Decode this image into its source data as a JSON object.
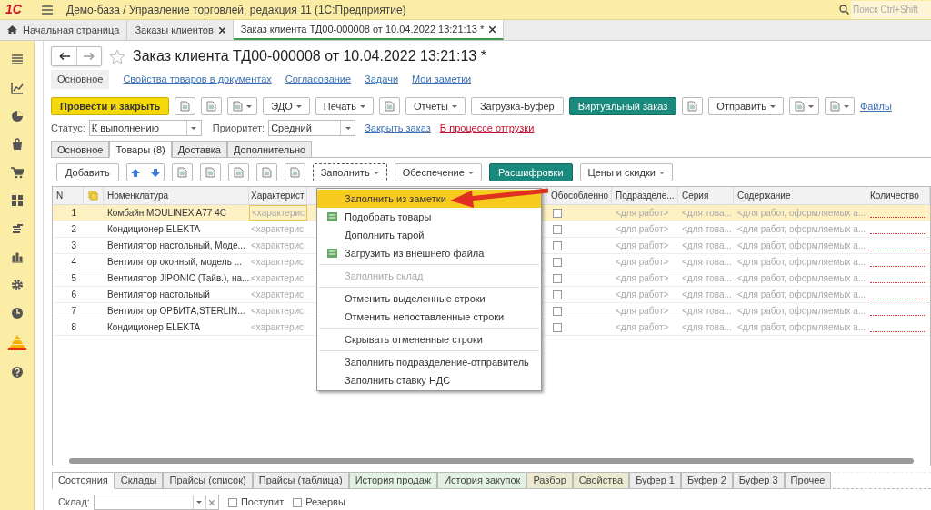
{
  "window": {
    "logo": "1С",
    "title": "Демо-база / Управление торговлей, редакция 11  (1С:Предприятие)",
    "search_placeholder": "Поиск Ctrl+Shift"
  },
  "tabs": [
    {
      "label": "Начальная страница",
      "selected": false,
      "closable": false
    },
    {
      "label": "Заказы клиентов",
      "selected": false,
      "closable": true
    },
    {
      "label": "Заказ клиента ТД00-000008 от 10.04.2022 13:21:13 *",
      "selected": true,
      "closable": true
    }
  ],
  "document": {
    "title": "Заказ клиента ТД00-000008 от 10.04.2022 13:21:13 *",
    "nav_links": [
      {
        "label": "Основное",
        "selected": true
      },
      {
        "label": "Свойства товаров в документах",
        "selected": false
      },
      {
        "label": "Согласование",
        "selected": false
      },
      {
        "label": "Задачи",
        "selected": false
      },
      {
        "label": "Мои заметки",
        "selected": false
      }
    ],
    "toolbar": [
      {
        "kind": "primary",
        "label": "Провести и закрыть"
      },
      {
        "kind": "icon"
      },
      {
        "kind": "icon"
      },
      {
        "kind": "icon_menu"
      },
      {
        "kind": "menu",
        "label": "ЭДО"
      },
      {
        "kind": "menu",
        "label": "Печать"
      },
      {
        "kind": "icon"
      },
      {
        "kind": "menu",
        "label": "Отчеты"
      },
      {
        "kind": "button",
        "label": "Загрузка-Буфер"
      },
      {
        "kind": "teal",
        "label": "Виртуальный заказ"
      },
      {
        "kind": "icon"
      },
      {
        "kind": "menu",
        "label": "Отправить"
      },
      {
        "kind": "icon_menu"
      },
      {
        "kind": "icon_menu"
      },
      {
        "kind": "link",
        "label": "Файлы"
      }
    ],
    "status": {
      "label": "Статус:",
      "value": "К выполнению"
    },
    "priority": {
      "label": "Приоритет:",
      "value": "Средний"
    },
    "close_link": "Закрыть заказ",
    "state_link": "В процессе отгрузки",
    "form_tabs": [
      {
        "label": "Основное",
        "selected": false
      },
      {
        "label": "Товары (8)",
        "selected": true
      },
      {
        "label": "Доставка",
        "selected": false
      },
      {
        "label": "Дополнительно",
        "selected": false
      }
    ]
  },
  "table_toolbar": [
    {
      "kind": "button",
      "label": "Добавить"
    },
    {
      "kind": "arrows"
    },
    {
      "kind": "icon"
    },
    {
      "kind": "icon"
    },
    {
      "kind": "icon"
    },
    {
      "kind": "icon"
    },
    {
      "kind": "icon"
    },
    {
      "kind": "menu",
      "label": "Заполнить",
      "selected": true
    },
    {
      "kind": "menu",
      "label": "Обеспечение",
      "selected": false
    },
    {
      "kind": "teal",
      "label": "Расшифровки"
    },
    {
      "kind": "menu",
      "label": "Цены и скидки",
      "selected": false
    }
  ],
  "table": {
    "columns": [
      "N",
      "Номенклатура",
      "Характерист",
      "Обособленно",
      "Подразделе...",
      "Серия",
      "Содержание",
      "Количество"
    ],
    "rows": [
      {
        "n": "1",
        "name": "Комбайн MOULINEX  A77 4C",
        "characteristic": "<характерис",
        "separate": false,
        "department": "<для работ>",
        "series": "<для това...",
        "content": "<для работ, оформляемых а...",
        "selected": true
      },
      {
        "n": "2",
        "name": "Кондиционер ELEKTA",
        "characteristic": "<характерис",
        "separate": false,
        "department": "<для работ>",
        "series": "<для това...",
        "content": "<для работ, оформляемых а...",
        "selected": false
      },
      {
        "n": "3",
        "name": "Вентилятор настольный, Моде...",
        "characteristic": "<характерис",
        "separate": false,
        "department": "<для работ>",
        "series": "<для това...",
        "content": "<для работ, оформляемых а...",
        "selected": false
      },
      {
        "n": "4",
        "name": "Вентилятор оконный, модель ...",
        "characteristic": "<характерис",
        "separate": false,
        "department": "<для работ>",
        "series": "<для това...",
        "content": "<для работ, оформляемых а...",
        "selected": false
      },
      {
        "n": "5",
        "name": "Вентилятор JIPONIC (Тайв.), на...",
        "characteristic": "<характерис",
        "separate": false,
        "department": "<для работ>",
        "series": "<для това...",
        "content": "<для работ, оформляемых а...",
        "selected": false
      },
      {
        "n": "6",
        "name": "Вентилятор настольный",
        "characteristic": "<характерис",
        "separate": false,
        "department": "<для работ>",
        "series": "<для това...",
        "content": "<для работ, оформляемых а...",
        "selected": false
      },
      {
        "n": "7",
        "name": "Вентилятор ОРБИТА,STERLIN...",
        "characteristic": "<характерис",
        "separate": false,
        "department": "<для работ>",
        "series": "<для това...",
        "content": "<для работ, оформляемых а...",
        "selected": false
      },
      {
        "n": "8",
        "name": "Кондиционер ELEKTA",
        "characteristic": "<характерис",
        "separate": false,
        "department": "<для работ>",
        "series": "<для това...",
        "content": "<для работ, оформляемых а...",
        "selected": false
      }
    ]
  },
  "fill_menu": [
    {
      "kind": "item",
      "label": "Заполнить из заметки",
      "selected": true,
      "disabled": false,
      "icon": false
    },
    {
      "kind": "item",
      "label": "Подобрать товары",
      "selected": false,
      "disabled": false,
      "icon": true
    },
    {
      "kind": "item",
      "label": "Дополнить тарой",
      "selected": false,
      "disabled": false,
      "icon": false
    },
    {
      "kind": "item",
      "label": "Загрузить из внешнего файла",
      "selected": false,
      "disabled": false,
      "icon": true
    },
    {
      "kind": "separator"
    },
    {
      "kind": "item",
      "label": "Заполнить склад",
      "selected": false,
      "disabled": true,
      "icon": false
    },
    {
      "kind": "separator"
    },
    {
      "kind": "item",
      "label": "Отменить выделенные строки",
      "selected": false,
      "disabled": false,
      "icon": false
    },
    {
      "kind": "item",
      "label": "Отменить непоставленные строки",
      "selected": false,
      "disabled": false,
      "icon": false
    },
    {
      "kind": "separator"
    },
    {
      "kind": "item",
      "label": "Скрывать отмененные строки",
      "selected": false,
      "disabled": false,
      "icon": false
    },
    {
      "kind": "separator"
    },
    {
      "kind": "item",
      "label": "Заполнить подразделение-отправитель",
      "selected": false,
      "disabled": false,
      "icon": false
    },
    {
      "kind": "item",
      "label": "Заполнить ставку НДС",
      "selected": false,
      "disabled": false,
      "icon": false
    }
  ],
  "bottom_tabs": [
    {
      "label": "Состояния",
      "selected": true,
      "color": "#ffffff"
    },
    {
      "label": "Склады",
      "selected": false,
      "color": "#ececec"
    },
    {
      "label": "Прайсы (список)",
      "selected": false,
      "color": "#ececec"
    },
    {
      "label": "Прайсы (таблица)",
      "selected": false,
      "color": "#ececec"
    },
    {
      "label": "История продаж",
      "selected": false,
      "color": "#e3f1e3"
    },
    {
      "label": "История закупок",
      "selected": false,
      "color": "#e3f1e3"
    },
    {
      "label": "Разбор",
      "selected": false,
      "color": "#ebe9cf"
    },
    {
      "label": "Свойства",
      "selected": false,
      "color": "#ebe9cf"
    },
    {
      "label": "Буфер 1",
      "selected": false,
      "color": "#ececec"
    },
    {
      "label": "Буфер 2",
      "selected": false,
      "color": "#ececec"
    },
    {
      "label": "Буфер 3",
      "selected": false,
      "color": "#ececec"
    },
    {
      "label": "Прочее",
      "selected": false,
      "color": "#ececec"
    }
  ],
  "filter": {
    "warehouse_label": "Склад:",
    "checkboxes": [
      {
        "label": "Поступит",
        "checked": false
      },
      {
        "label": "Резервы",
        "checked": false
      }
    ]
  }
}
